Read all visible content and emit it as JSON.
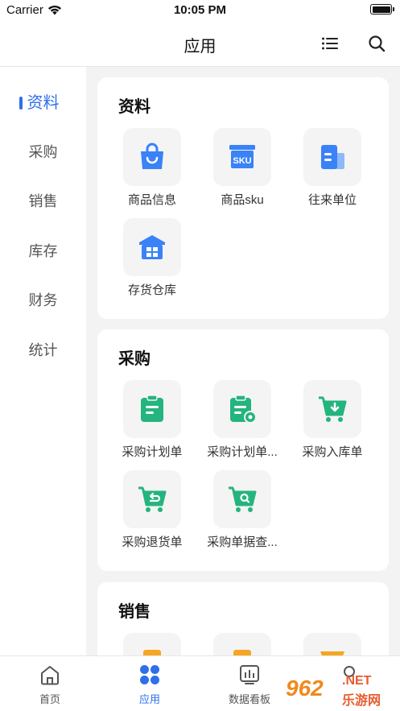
{
  "status_bar": {
    "carrier": "Carrier",
    "time": "10:05 PM",
    "battery_level": 1.0
  },
  "nav": {
    "title": "应用",
    "list_icon": "list-icon",
    "search_icon": "search-icon"
  },
  "sidebar": {
    "items": [
      {
        "label": "资料",
        "active": true
      },
      {
        "label": "采购",
        "active": false
      },
      {
        "label": "销售",
        "active": false
      },
      {
        "label": "库存",
        "active": false
      },
      {
        "label": "财务",
        "active": false
      },
      {
        "label": "统计",
        "active": false
      }
    ]
  },
  "sections": [
    {
      "title": "资料",
      "apps": [
        {
          "label": "商品信息",
          "icon": "shopping-bag-icon"
        },
        {
          "label": "商品sku",
          "icon": "sku-box-icon",
          "icon_text": "SKU"
        },
        {
          "label": "往来单位",
          "icon": "building-icon"
        },
        {
          "label": "存货仓库",
          "icon": "warehouse-icon"
        }
      ]
    },
    {
      "title": "采购",
      "apps": [
        {
          "label": "采购计划单",
          "icon": "clipboard-icon"
        },
        {
          "label": "采购计划单...",
          "icon": "clipboard-settings-icon"
        },
        {
          "label": "采购入库单",
          "icon": "cart-download-icon"
        },
        {
          "label": "采购退货单",
          "icon": "cart-return-icon"
        },
        {
          "label": "采购单据查...",
          "icon": "cart-search-icon"
        }
      ]
    },
    {
      "title": "销售",
      "apps": []
    }
  ],
  "tab_bar": {
    "tabs": [
      {
        "label": "首页",
        "icon": "home-icon",
        "active": false
      },
      {
        "label": "应用",
        "icon": "apps-icon",
        "active": true
      },
      {
        "label": "数据看板",
        "icon": "chart-board-icon",
        "active": false
      },
      {
        "label": "",
        "icon": "profile-icon",
        "active": false
      }
    ]
  },
  "colors": {
    "accent": "#2f6fe8",
    "blue_icon": "#3a82f7",
    "green_icon": "#24b47e",
    "orange_icon": "#f5a623"
  },
  "watermark": {
    "number": "962",
    "net": ".NET",
    "site": "乐游网"
  }
}
